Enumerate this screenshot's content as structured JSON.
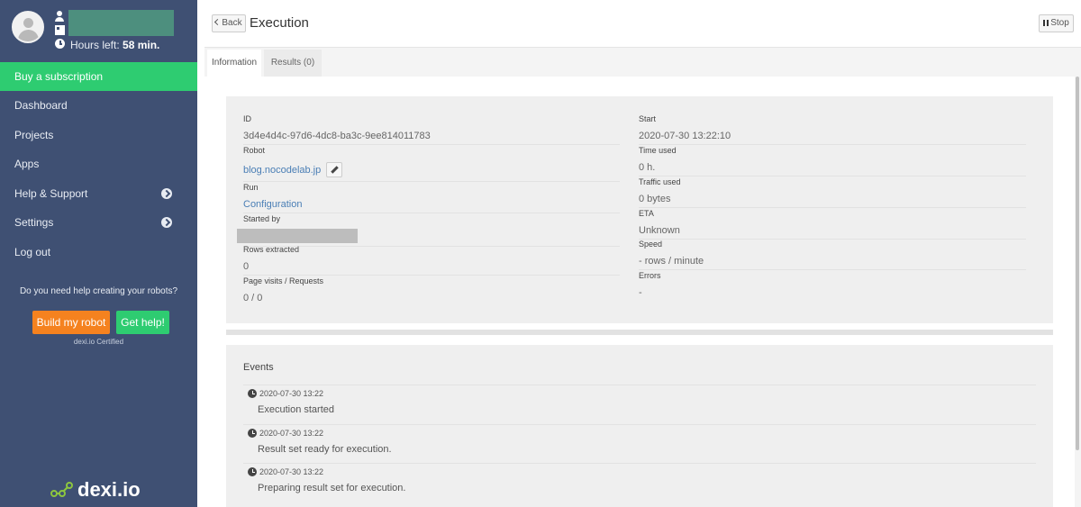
{
  "sidebar": {
    "hours_label": "Hours left:",
    "hours_value": "58 min.",
    "items": [
      {
        "label": "Buy a subscription"
      },
      {
        "label": "Dashboard"
      },
      {
        "label": "Projects"
      },
      {
        "label": "Apps"
      },
      {
        "label": "Help & Support"
      },
      {
        "label": "Settings"
      },
      {
        "label": "Log out"
      }
    ],
    "help_question": "Do you need help creating your robots?",
    "build_button": "Build my robot",
    "help_button": "Get help!",
    "certified": "dexi.io Certified",
    "logo_text": "dexi.io",
    "colors": {
      "sidebar_bg": "#3f5073",
      "active_green": "#2ecc71",
      "orange": "#f5821f"
    }
  },
  "header": {
    "back_label": "Back",
    "title": "Execution",
    "stop_label": "Stop"
  },
  "tabs": [
    {
      "label": "Information"
    },
    {
      "label": "Results (0)"
    }
  ],
  "info": {
    "left": [
      {
        "label": "ID",
        "value": "3d4e4d4c-97d6-4dc8-ba3c-9ee814011783"
      },
      {
        "label": "Robot",
        "value": "blog.nocodelab.jp"
      },
      {
        "label": "Run",
        "value": "Configuration"
      },
      {
        "label": "Started by",
        "value": ""
      },
      {
        "label": "Rows extracted",
        "value": "0"
      },
      {
        "label": "Page visits / Requests",
        "value": "0 / 0"
      }
    ],
    "right": [
      {
        "label": "Start",
        "value": "2020-07-30 13:22:10"
      },
      {
        "label": "Time used",
        "value": "0 h."
      },
      {
        "label": "Traffic used",
        "value": "0 bytes"
      },
      {
        "label": "ETA",
        "value": "Unknown"
      },
      {
        "label": "Speed",
        "value": "- rows / minute"
      },
      {
        "label": "Errors",
        "value": "-"
      }
    ]
  },
  "events": {
    "title": "Events",
    "items": [
      {
        "time": "2020-07-30 13:22",
        "text": "Execution started"
      },
      {
        "time": "2020-07-30 13:22",
        "text": "Result set ready for execution."
      },
      {
        "time": "2020-07-30 13:22",
        "text": "Preparing result set for execution."
      }
    ]
  }
}
